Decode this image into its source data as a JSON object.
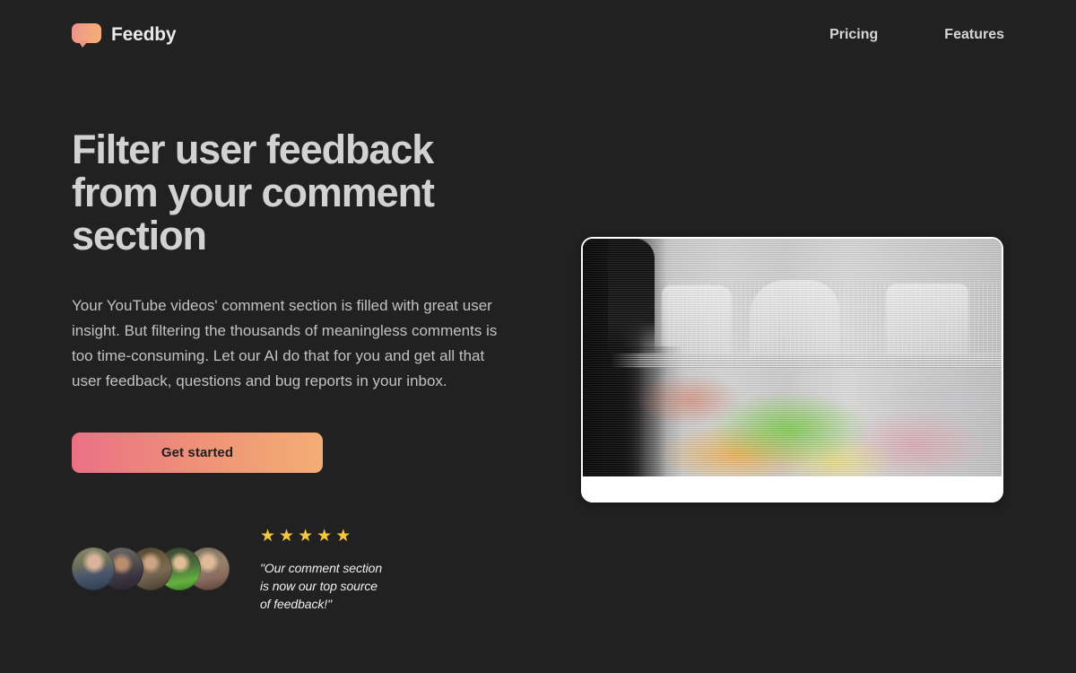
{
  "header": {
    "brand_name": "Feedby",
    "logo_icon": "speech-bubble-icon",
    "nav": [
      {
        "label": "Pricing"
      },
      {
        "label": "Features"
      }
    ]
  },
  "hero": {
    "headline": "Filter user feedback from your comment section",
    "subcopy": "Your YouTube videos' comment section is filled with great user insight. But filtering the thousands of meaningless comments is too time-consuming. Let our AI do that for you and get all that user feedback, questions and bug reports in your inbox.",
    "cta_label": "Get started"
  },
  "social_proof": {
    "avatar_count": 5,
    "avatars": [
      {
        "alt": "avatar-1"
      },
      {
        "alt": "avatar-2"
      },
      {
        "alt": "avatar-3"
      },
      {
        "alt": "avatar-4"
      },
      {
        "alt": "avatar-5"
      }
    ],
    "rating": {
      "stars_filled": 5,
      "star_glyph": "★",
      "star_color": "#f5c83c"
    },
    "quote": "\"Our comment section\nis now our top source\nof feedback!\""
  },
  "media": {
    "alt": "glitched-datamosh-photo",
    "card_background": "#ffffff"
  },
  "theme": {
    "page_background": "#212121",
    "headline_color": "#d2d2d2",
    "body_text_color": "#c2c2c2",
    "cta_gradient_start": "#ea7185",
    "cta_gradient_end": "#f3ae74",
    "cta_text_color": "#1f1f1f"
  }
}
